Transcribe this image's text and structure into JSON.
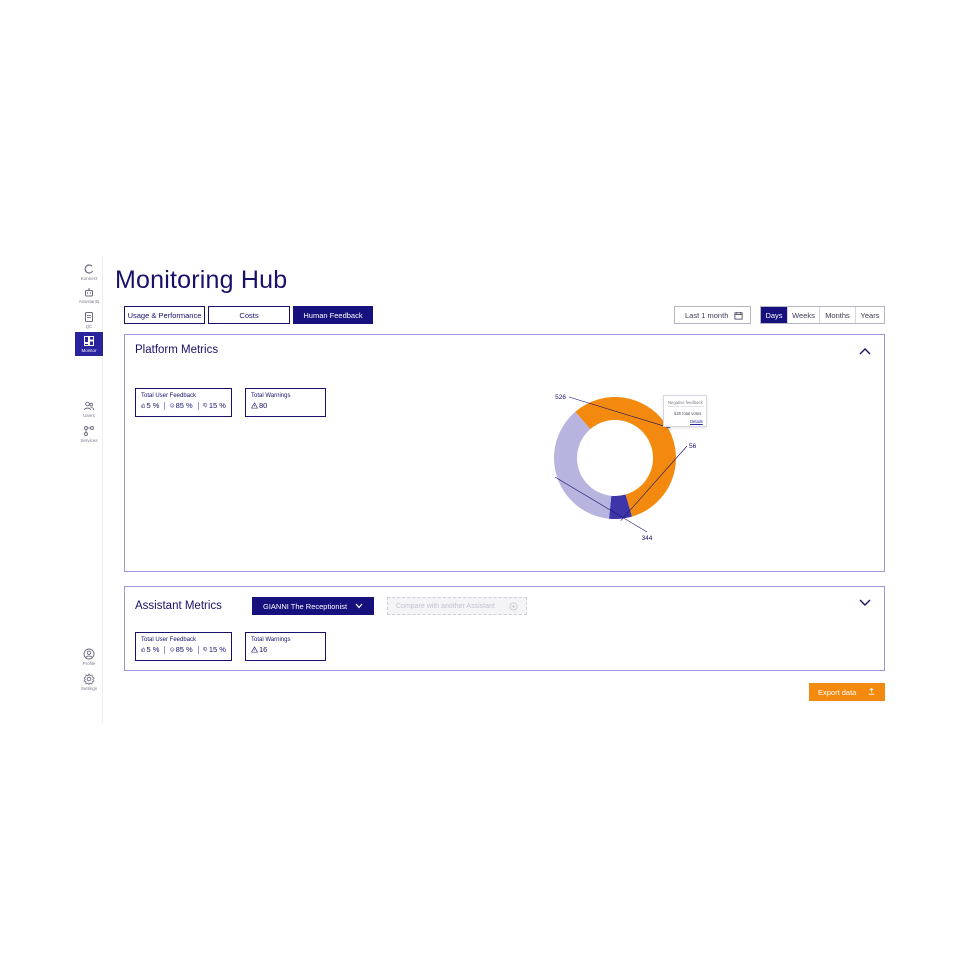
{
  "page": {
    "title": "Monitoring Hub"
  },
  "sidebar": {
    "items": [
      {
        "label": "Konnect",
        "icon": "konnect-icon",
        "active": false
      },
      {
        "label": "Assistants",
        "icon": "robot-icon",
        "active": false
      },
      {
        "label": "QC",
        "icon": "qc-icon",
        "active": false
      },
      {
        "label": "Monitor",
        "icon": "dashboard-icon",
        "active": true
      },
      {
        "label": "Users",
        "icon": "users-icon",
        "active": false
      },
      {
        "label": "Services",
        "icon": "services-icon",
        "active": false
      }
    ],
    "bottom_items": [
      {
        "label": "Profile",
        "icon": "profile-icon"
      },
      {
        "label": "Settings",
        "icon": "gear-icon"
      }
    ]
  },
  "tabs": [
    {
      "label": "Usage & Performance",
      "active": false
    },
    {
      "label": "Costs",
      "active": false
    },
    {
      "label": "Human Feedback",
      "active": true
    }
  ],
  "date_filter": {
    "value": "Last 1 month",
    "icon": "calendar-icon"
  },
  "period": {
    "options": [
      "Days",
      "Weeks",
      "Months",
      "Years"
    ],
    "selected": "Days"
  },
  "platform_metrics": {
    "title": "Platform Metrics",
    "expanded": true,
    "feedback_card": {
      "title": "Total User Feedback",
      "positive": "5 %",
      "neutral": "85 %",
      "negative": "15 %"
    },
    "warnings_card": {
      "title": "Total Warnings",
      "value": "80"
    },
    "tooltip": {
      "title": "Negative feedback",
      "votes": "526 total votes",
      "link": "Details"
    }
  },
  "chart_data": {
    "type": "pie",
    "donut": true,
    "slices": [
      {
        "label": "526",
        "value": 526,
        "color": "#f38a0f"
      },
      {
        "label": "56",
        "value": 56,
        "color": "#3d35a8"
      },
      {
        "label": "344",
        "value": 344,
        "color": "#b8b4e0"
      }
    ]
  },
  "assistant_metrics": {
    "title": "Assistant Metrics",
    "expanded": false,
    "selected_assistant": "GIANNI The Receptionist",
    "compare_label": "Compare with another Assistant",
    "feedback_card": {
      "title": "Total User Feedback",
      "positive": "5 %",
      "neutral": "85 %",
      "negative": "15 %"
    },
    "warnings_card": {
      "title": "Total Warnings",
      "value": "16"
    }
  },
  "export": {
    "label": "Export data"
  },
  "colors": {
    "primary": "#17117d",
    "accent": "#f38a0f",
    "panel_border": "#9c97d8"
  }
}
